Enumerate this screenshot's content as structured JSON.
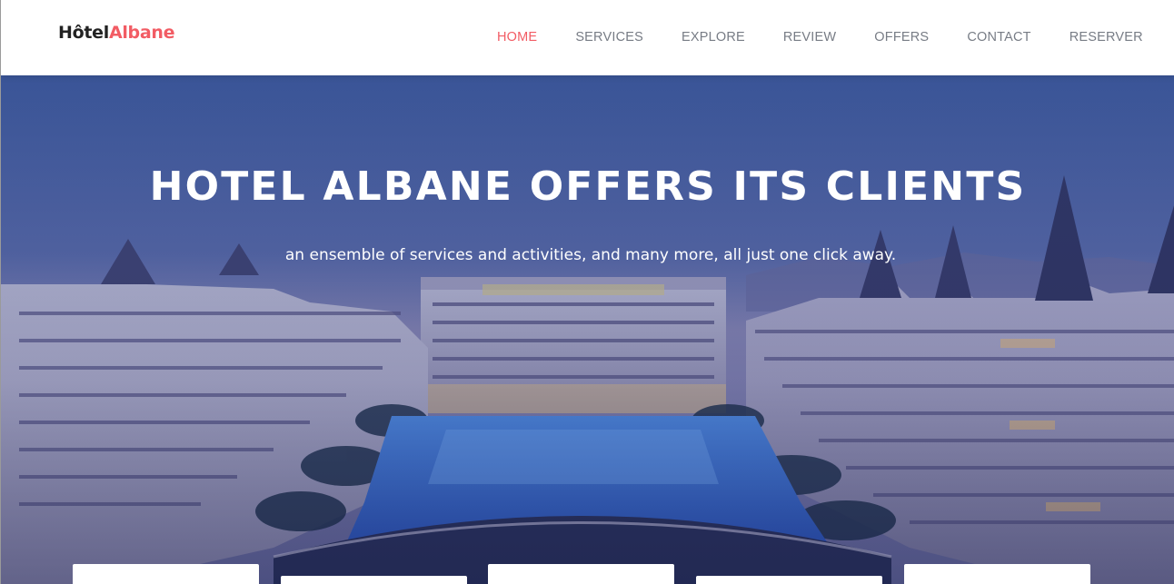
{
  "brand": {
    "part1": "Hôtel",
    "part2": "Albane"
  },
  "nav": {
    "items": [
      {
        "label": "HOME",
        "active": true
      },
      {
        "label": "SERVICES",
        "active": false
      },
      {
        "label": "EXPLORE",
        "active": false
      },
      {
        "label": "REVIEW",
        "active": false
      },
      {
        "label": "OFFERS",
        "active": false
      },
      {
        "label": "CONTACT",
        "active": false
      },
      {
        "label": "RESERVER",
        "active": false
      }
    ]
  },
  "hero": {
    "title": "HOTEL ALBANE OFFERS ITS CLIENTS",
    "subtitle": "an ensemble of services and activities, and many more, all just one click away."
  },
  "colors": {
    "accent": "#f25c64",
    "nav_text": "#777c85",
    "brand_text": "#222222"
  },
  "cards": [
    {
      "id": "card-1"
    },
    {
      "id": "card-2"
    },
    {
      "id": "card-3"
    },
    {
      "id": "card-4"
    },
    {
      "id": "card-5"
    }
  ]
}
